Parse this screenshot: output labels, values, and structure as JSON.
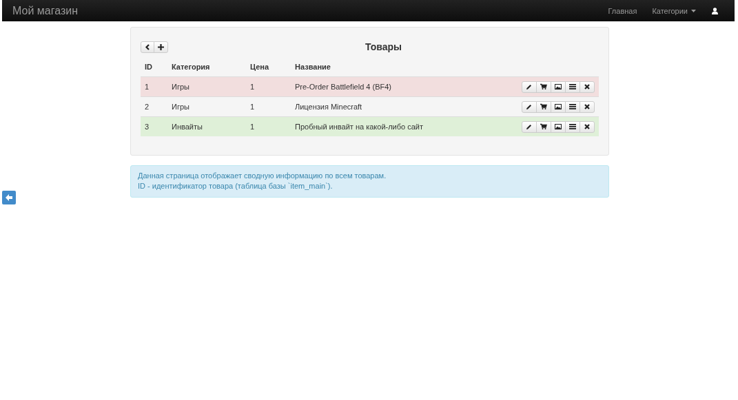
{
  "navbar": {
    "brand": "Мой магазин",
    "links": [
      {
        "label": "Главная",
        "dropdown": false
      },
      {
        "label": "Категории",
        "dropdown": true
      }
    ]
  },
  "panel": {
    "title": "Товары",
    "columns": [
      "ID",
      "Категория",
      "Цена",
      "Название"
    ],
    "rows": [
      {
        "id": "1",
        "category": "Игры",
        "price": "1",
        "name": "Pre-Order Battlefield 4 (BF4)",
        "color": "#f2dede"
      },
      {
        "id": "2",
        "category": "Игры",
        "price": "1",
        "name": "Лицензия Minecraft"
      },
      {
        "id": "3",
        "category": "Инвайты",
        "price": "1",
        "name": "Пробный инвайт на какой-либо сайт",
        "color": "#dff0d8"
      }
    ]
  },
  "info": [
    "Данная страница отображает сводную информацию по всем товарам.",
    "ID - идентификатор товара (таблица базы `item_main`)."
  ]
}
